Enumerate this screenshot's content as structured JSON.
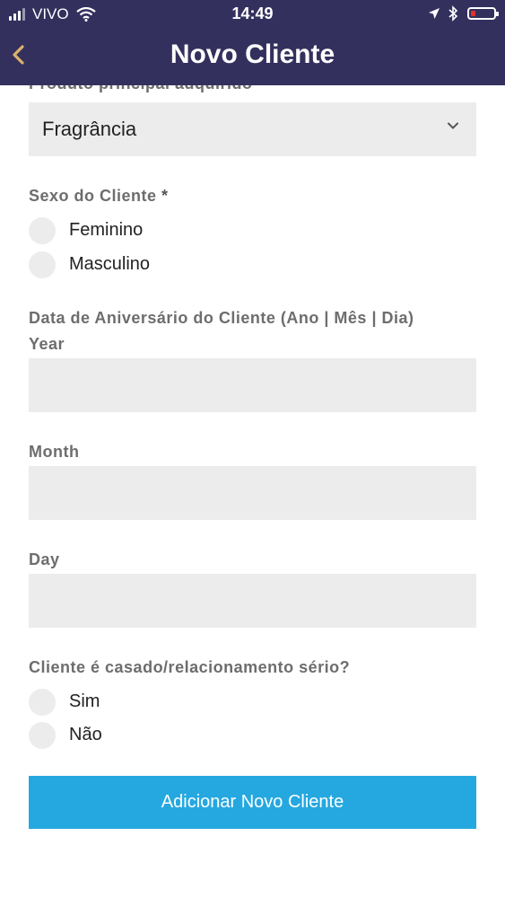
{
  "status_bar": {
    "carrier": "VIVO",
    "time": "14:49"
  },
  "nav": {
    "title": "Novo Cliente",
    "back_icon": "chevron-left-icon"
  },
  "form": {
    "product": {
      "label": "Produto principal adquirido *",
      "value": "Fragrância"
    },
    "sex": {
      "label": "Sexo do Cliente",
      "required_mark": "*",
      "options": [
        "Feminino",
        "Masculino"
      ]
    },
    "birthday": {
      "label": "Data de Aniversário do Cliente (Ano | Mês | Dia)",
      "year_label": "Year",
      "month_label": "Month",
      "day_label": "Day"
    },
    "married": {
      "label": "Cliente é casado/relacionamento sério?",
      "options": [
        "Sim",
        "Não"
      ]
    },
    "submit_label": "Adicionar Novo Cliente"
  },
  "colors": {
    "header_bg": "#34305e",
    "accent": "#d9b36a",
    "button_bg": "#25a8e0",
    "field_bg": "#ececec"
  }
}
